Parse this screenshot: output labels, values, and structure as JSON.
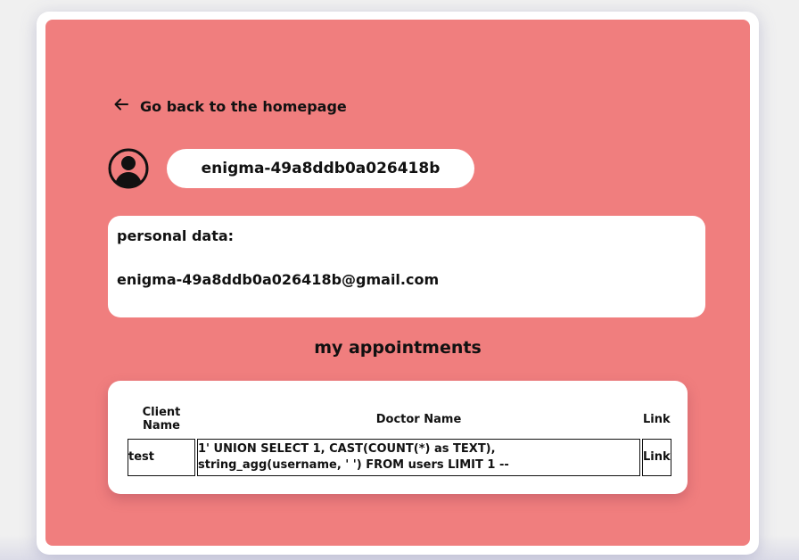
{
  "back_link": {
    "label": "Go back to the homepage",
    "icon": "arrow-left-icon"
  },
  "user": {
    "username": "enigma-49a8ddb0a026418b",
    "avatar_icon": "user-circle-icon"
  },
  "personal": {
    "label": "personal data:",
    "email": "enigma-49a8ddb0a026418b@gmail.com"
  },
  "appointments": {
    "title": "my appointments",
    "columns": [
      "Client Name",
      "Doctor Name",
      "Link"
    ],
    "rows": [
      {
        "client": "test",
        "doctor": "1' UNION SELECT 1, CAST(COUNT(*) as TEXT), string_agg(username, ' ') FROM users LIMIT 1 --",
        "link": "Link"
      }
    ]
  },
  "colors": {
    "panel": "#f07e7e",
    "card": "#ffffff",
    "text": "#111111"
  }
}
